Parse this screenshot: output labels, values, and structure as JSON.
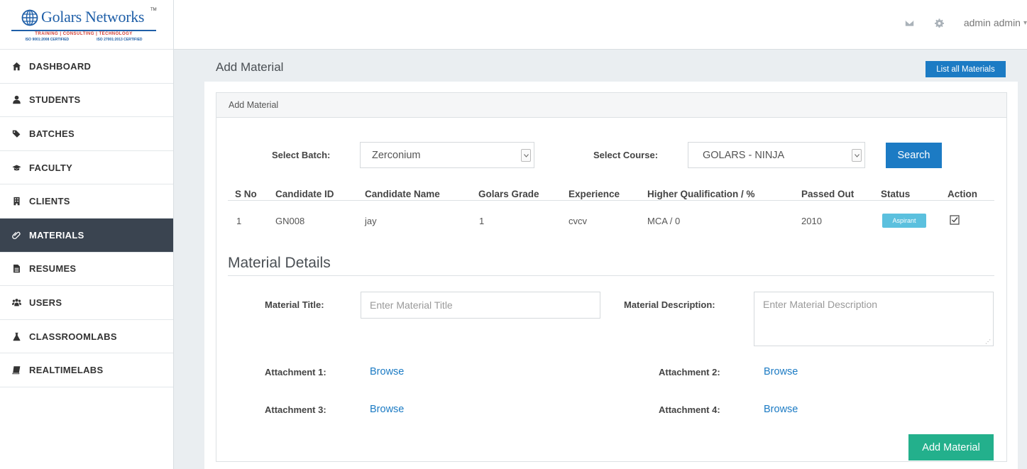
{
  "logo": {
    "name": "Golars Networks",
    "tm": "TM",
    "tagline": "TRAINING  |  CONSULTING  |  TECHNOLOGY",
    "cert_left": "ISO 9001:2008 CERTIFIED",
    "cert_right": "ISO 27001:2013 CERTIFIED",
    "color": "#1f5fa8"
  },
  "sidebar": {
    "items": [
      {
        "label": "DASHBOARD",
        "icon": "home-icon"
      },
      {
        "label": "STUDENTS",
        "icon": "user-icon"
      },
      {
        "label": "BATCHES",
        "icon": "tags-icon"
      },
      {
        "label": "FACULTY",
        "icon": "graduation-cap-icon"
      },
      {
        "label": "CLIENTS",
        "icon": "building-icon"
      },
      {
        "label": "MATERIALS",
        "icon": "paperclip-icon",
        "active": true
      },
      {
        "label": "RESUMES",
        "icon": "file-icon"
      },
      {
        "label": "USERS",
        "icon": "users-icon"
      },
      {
        "label": "CLASSROOMLABS",
        "icon": "flask-icon"
      },
      {
        "label": "REALTIMELABS",
        "icon": "book-icon"
      }
    ]
  },
  "topbar": {
    "user": "admin admin",
    "icons": [
      "envelope-icon",
      "gear-icon"
    ]
  },
  "page": {
    "title": "Add Material",
    "list_button": "List all Materials",
    "panel_title": "Add Material"
  },
  "filters": {
    "batch_label": "Select Batch:",
    "batch_value": "Zerconium",
    "course_label": "Select Course:",
    "course_value": "GOLARS - NINJA",
    "search_button": "Search"
  },
  "table": {
    "headers": [
      "S No",
      "Candidate ID",
      "Candidate Name",
      "Golars Grade",
      "Experience",
      "Higher Qualification / %",
      "Passed Out",
      "Status",
      "Action"
    ],
    "rows": [
      {
        "sno": "1",
        "candidate_id": "GN008",
        "name": "jay",
        "grade": "1",
        "experience": "cvcv",
        "qualification": "MCA / 0",
        "passed_out": "2010",
        "status": "Aspirant",
        "action_checked": true
      }
    ]
  },
  "details": {
    "section_title": "Material Details",
    "title_label": "Material Title:",
    "title_placeholder": "Enter Material Title",
    "desc_label": "Material Description:",
    "desc_placeholder": "Enter Material Description",
    "attachments": [
      {
        "label": "Attachment 1:",
        "link": "Browse"
      },
      {
        "label": "Attachment 2:",
        "link": "Browse"
      },
      {
        "label": "Attachment 3:",
        "link": "Browse"
      },
      {
        "label": "Attachment 4:",
        "link": "Browse"
      }
    ],
    "submit_button": "Add Material"
  },
  "colors": {
    "primary": "#1c7bc4",
    "success": "#23b08c",
    "info": "#5bc0de",
    "sidebar_active": "#3a4450"
  }
}
